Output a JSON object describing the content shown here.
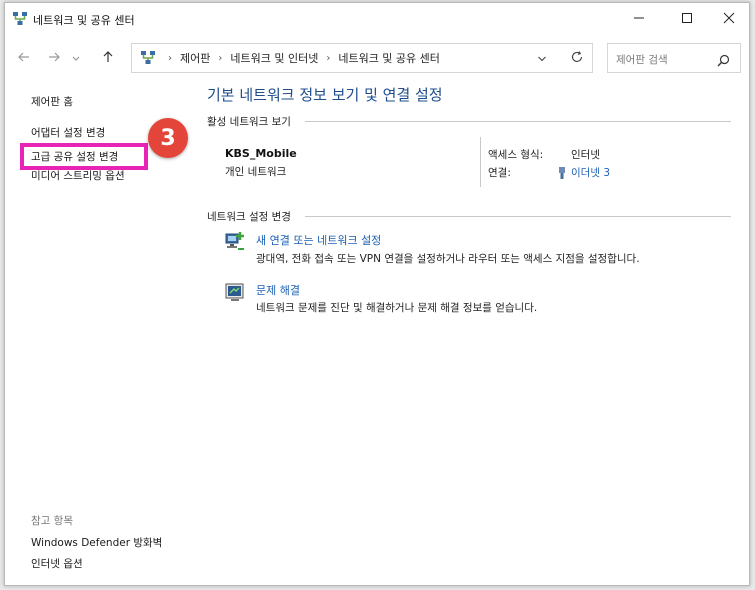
{
  "window": {
    "title": "네트워크 및 공유 센터"
  },
  "address": {
    "crumbs": [
      "제어판",
      "네트워크 및 인터넷",
      "네트워크 및 공유 센터"
    ]
  },
  "search": {
    "placeholder": "제어판 검색"
  },
  "sidebar": {
    "links": [
      "제어판 홈",
      "어댑터 설정 변경",
      "고급 공유 설정 변경",
      "미디어 스트리밍 옵션"
    ],
    "see_also_label": "참고 항목",
    "see_also": [
      "Windows Defender 방화벽",
      "인터넷 옵션"
    ]
  },
  "annotation": {
    "step": "3",
    "color": "#ea23b7",
    "badge_color": "#e4453b"
  },
  "main": {
    "title": "기본 네트워크 정보 보기 및 연결 설정",
    "active_networks_label": "활성 네트워크 보기",
    "network": {
      "name": "KBS_Mobile",
      "type": "개인 네트워크",
      "access_type_label": "액세스 형식:",
      "access_type_value": "인터넷",
      "connection_label": "연결:",
      "connection_value": "이더넷 3"
    },
    "change_settings_label": "네트워크 설정 변경",
    "tasks": [
      {
        "link": "새 연결 또는 네트워크 설정",
        "desc": "광대역, 전화 접속 또는 VPN 연결을 설정하거나 라우터 또는 액세스 지점을 설정합니다.",
        "icon": "new-connection-icon"
      },
      {
        "link": "문제 해결",
        "desc": "네트워크 문제를 진단 및 해결하거나 문제 해결 정보를 얻습니다.",
        "icon": "troubleshoot-icon"
      }
    ]
  },
  "colors": {
    "link": "#1a5fb4",
    "title": "#1e4e8c"
  }
}
